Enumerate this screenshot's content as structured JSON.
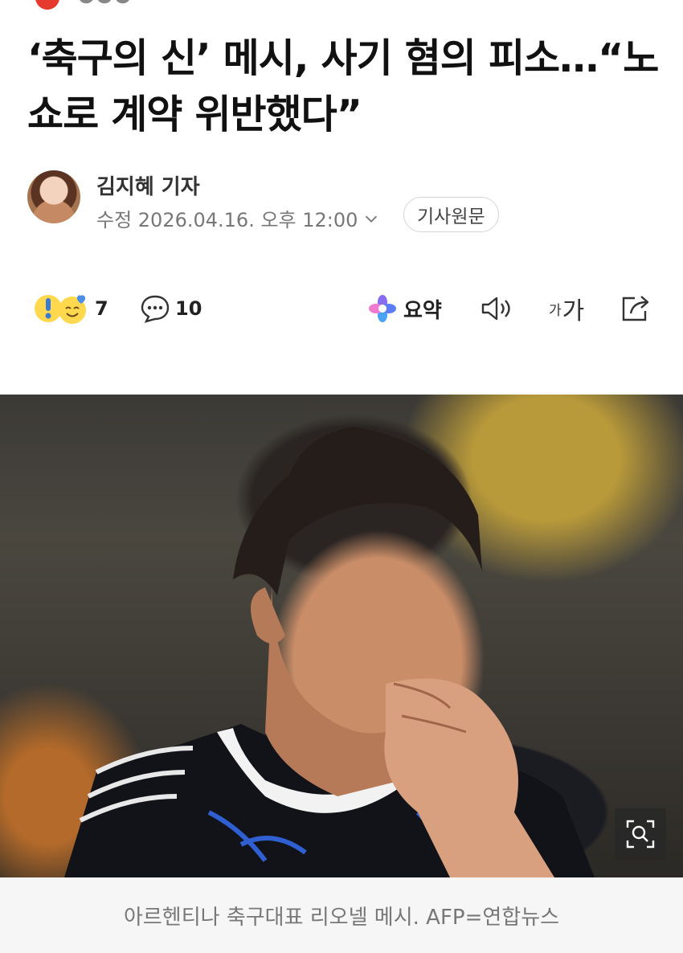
{
  "headline": "‘축구의 신’ 메시, 사기 혐의 피소…“노쇼로 계약 위반했다”",
  "byline": {
    "author": "김지혜 기자",
    "date_label": "수정 2026.04.16. 오후 12:00",
    "original_button": "기사원문"
  },
  "toolbar": {
    "reaction_count": "7",
    "comment_count": "10",
    "summary_label": "요약",
    "font_size_label": "가"
  },
  "photo": {
    "caption": "아르헨티나 축구대표 리오넬 메시. AFP=연합뉴스"
  },
  "colors": {
    "brand_red": "#e63a2e",
    "text": "#111111",
    "muted": "#777777"
  }
}
